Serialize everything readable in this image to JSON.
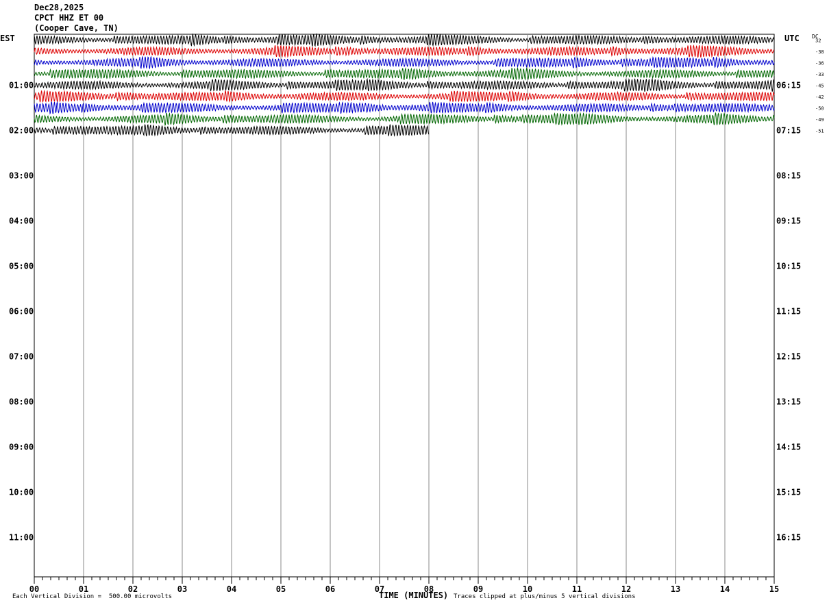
{
  "header": {
    "date": "Dec28,2025",
    "station": "CPCT HHZ ET 00",
    "location": "(Cooper Cave, TN)"
  },
  "left_zone": "EST",
  "right_zone": "UTC",
  "dc_label": "DC",
  "footer": {
    "scale_note": "Each Vertical Division =  500.00 microvolts",
    "xlabel": "TIME (MINUTES)",
    "clip_note": "Traces clipped at plus/minus 5 vertical divisions"
  },
  "chart_data": {
    "type": "line",
    "title": "CPCT HHZ ET 00",
    "xlabel": "TIME (MINUTES)",
    "x_ticks": [
      "00",
      "01",
      "02",
      "03",
      "04",
      "05",
      "06",
      "07",
      "08",
      "09",
      "10",
      "11",
      "12",
      "13",
      "14",
      "15"
    ],
    "xlim": [
      0,
      15
    ],
    "est_hour_labels": [
      "01:00",
      "02:00",
      "03:00",
      "04:00",
      "05:00",
      "06:00",
      "07:00",
      "08:00",
      "09:00",
      "10:00",
      "11:00"
    ],
    "utc_hour_labels": [
      "06:15",
      "07:15",
      "08:15",
      "09:15",
      "10:15",
      "11:15",
      "12:15",
      "13:15",
      "14:15",
      "15:15",
      "16:15"
    ],
    "rows_per_hour": 4,
    "total_rows": 48,
    "trace_colors": [
      "#000000",
      "#dd0000",
      "#0000cc",
      "#006600"
    ],
    "traces": [
      {
        "row": 0,
        "start_min": 0,
        "end_min": 15,
        "dc": "32",
        "color": "#000000"
      },
      {
        "row": 1,
        "start_min": 0,
        "end_min": 15,
        "dc": "-38",
        "color": "#dd0000"
      },
      {
        "row": 2,
        "start_min": 0,
        "end_min": 15,
        "dc": "-36",
        "color": "#0000cc"
      },
      {
        "row": 3,
        "start_min": 0,
        "end_min": 15,
        "dc": "-33",
        "color": "#006600"
      },
      {
        "row": 4,
        "start_min": 0,
        "end_min": 15,
        "dc": "-45",
        "color": "#000000"
      },
      {
        "row": 5,
        "start_min": 0,
        "end_min": 15,
        "dc": "-42",
        "color": "#dd0000"
      },
      {
        "row": 6,
        "start_min": 0,
        "end_min": 15,
        "dc": "-50",
        "color": "#0000cc"
      },
      {
        "row": 7,
        "start_min": 0,
        "end_min": 15,
        "dc": "-49",
        "color": "#006600"
      },
      {
        "row": 8,
        "start_min": 0,
        "end_min": 8,
        "dc": "-51",
        "color": "#000000"
      }
    ]
  }
}
